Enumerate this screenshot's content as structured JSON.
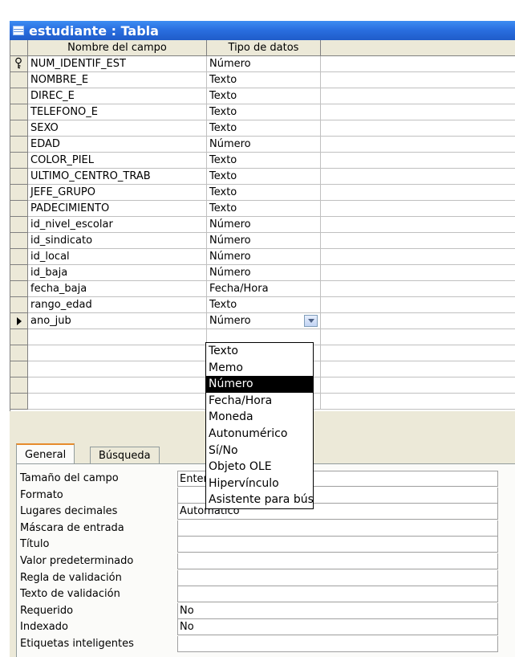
{
  "window": {
    "title": "estudiante : Tabla"
  },
  "grid": {
    "headers": [
      "Nombre del campo",
      "Tipo de datos",
      ""
    ],
    "rows": [
      {
        "name": "NUM_IDENTIF_EST",
        "type": "Número",
        "marker": "key"
      },
      {
        "name": "NOMBRE_E",
        "type": "Texto"
      },
      {
        "name": "DIREC_E",
        "type": "Texto"
      },
      {
        "name": "TELEFONO_E",
        "type": "Texto"
      },
      {
        "name": "SEXO",
        "type": "Texto"
      },
      {
        "name": "EDAD",
        "type": "Número"
      },
      {
        "name": "COLOR_PIEL",
        "type": "Texto"
      },
      {
        "name": "ULTIMO_CENTRO_TRAB",
        "type": "Texto"
      },
      {
        "name": "JEFE_GRUPO",
        "type": "Texto"
      },
      {
        "name": "PADECIMIENTO",
        "type": "Texto"
      },
      {
        "name": "id_nivel_escolar",
        "type": "Número"
      },
      {
        "name": "id_sindicato",
        "type": "Número"
      },
      {
        "name": "id_local",
        "type": "Número"
      },
      {
        "name": "id_baja",
        "type": "Número"
      },
      {
        "name": "fecha_baja",
        "type": "Fecha/Hora"
      },
      {
        "name": "rango_edad",
        "type": "Texto"
      },
      {
        "name": "ano_jub",
        "type": "Número",
        "marker": "current",
        "dropdown": true
      },
      {
        "name": "",
        "type": ""
      },
      {
        "name": "",
        "type": ""
      },
      {
        "name": "",
        "type": ""
      },
      {
        "name": "",
        "type": ""
      },
      {
        "name": "",
        "type": ""
      }
    ]
  },
  "dropdown": {
    "options": [
      "Texto",
      "Memo",
      "Número",
      "Fecha/Hora",
      "Moneda",
      "Autonumérico",
      "Sí/No",
      "Objeto OLE",
      "Hipervínculo",
      "Asistente para búsqueda..."
    ],
    "selected": "Número"
  },
  "properties": {
    "tabs": [
      "General",
      "Búsqueda"
    ],
    "active_tab": "General",
    "rows": [
      {
        "label": "Tamaño del campo",
        "value": "Entero"
      },
      {
        "label": "Formato",
        "value": ""
      },
      {
        "label": "Lugares decimales",
        "value": "Automático"
      },
      {
        "label": "Máscara de entrada",
        "value": ""
      },
      {
        "label": "Título",
        "value": ""
      },
      {
        "label": "Valor predeterminado",
        "value": ""
      },
      {
        "label": "Regla de validación",
        "value": ""
      },
      {
        "label": "Texto de validación",
        "value": ""
      },
      {
        "label": "Requerido",
        "value": "No"
      },
      {
        "label": "Indexado",
        "value": "No"
      },
      {
        "label": "Etiquetas inteligentes",
        "value": ""
      }
    ]
  },
  "colors": {
    "titlebar": "#2a6fe0",
    "panel": "#ece9d8",
    "highlight": "#000000"
  }
}
